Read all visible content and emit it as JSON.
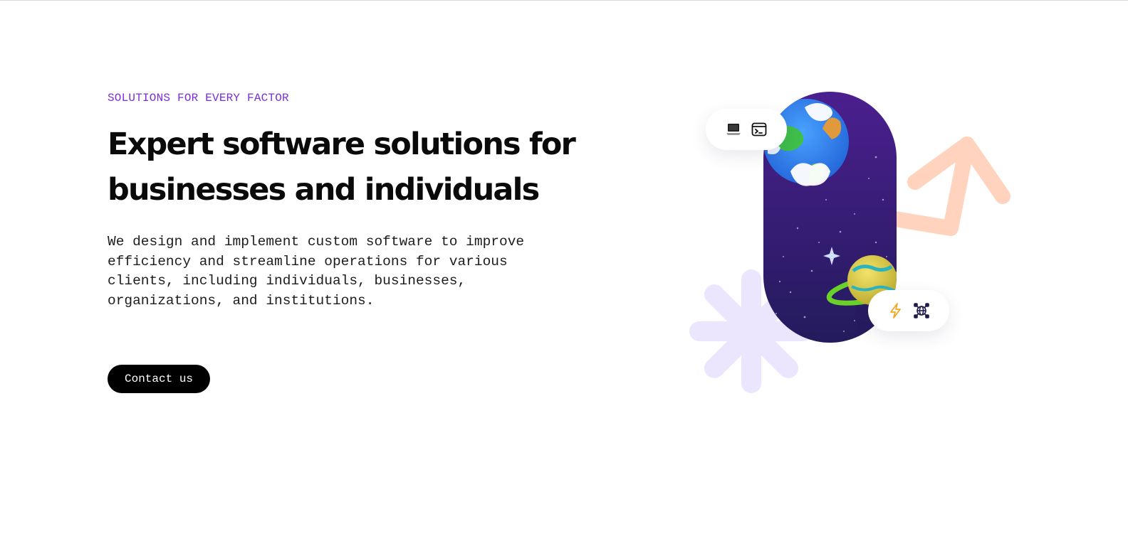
{
  "hero": {
    "eyebrow": "SOLUTIONS FOR EVERY FACTOR",
    "headline": "Expert software solutions for businesses and individuals",
    "description": "We design and implement custom software to improve efficiency and streamline operations for various clients, including individuals, businesses, organizations, and institutions.",
    "cta_label": "Contact us"
  },
  "illustration": {
    "top_card_icons": [
      "laptop-icon",
      "terminal-icon"
    ],
    "bottom_card_icons": [
      "lightning-icon",
      "network-globe-icon"
    ]
  },
  "colors": {
    "eyebrow": "#7a2fd6",
    "headline": "#0a0a0a",
    "button_bg": "#000000",
    "button_text": "#ffffff",
    "space_dark": "#2a1f6b",
    "space_purple": "#4b1f8f",
    "arrow_peach": "#ffd3bd",
    "asterisk_lavender": "#ebe6fd",
    "lightning": "#f5a623",
    "network": "#1e1b4b"
  }
}
